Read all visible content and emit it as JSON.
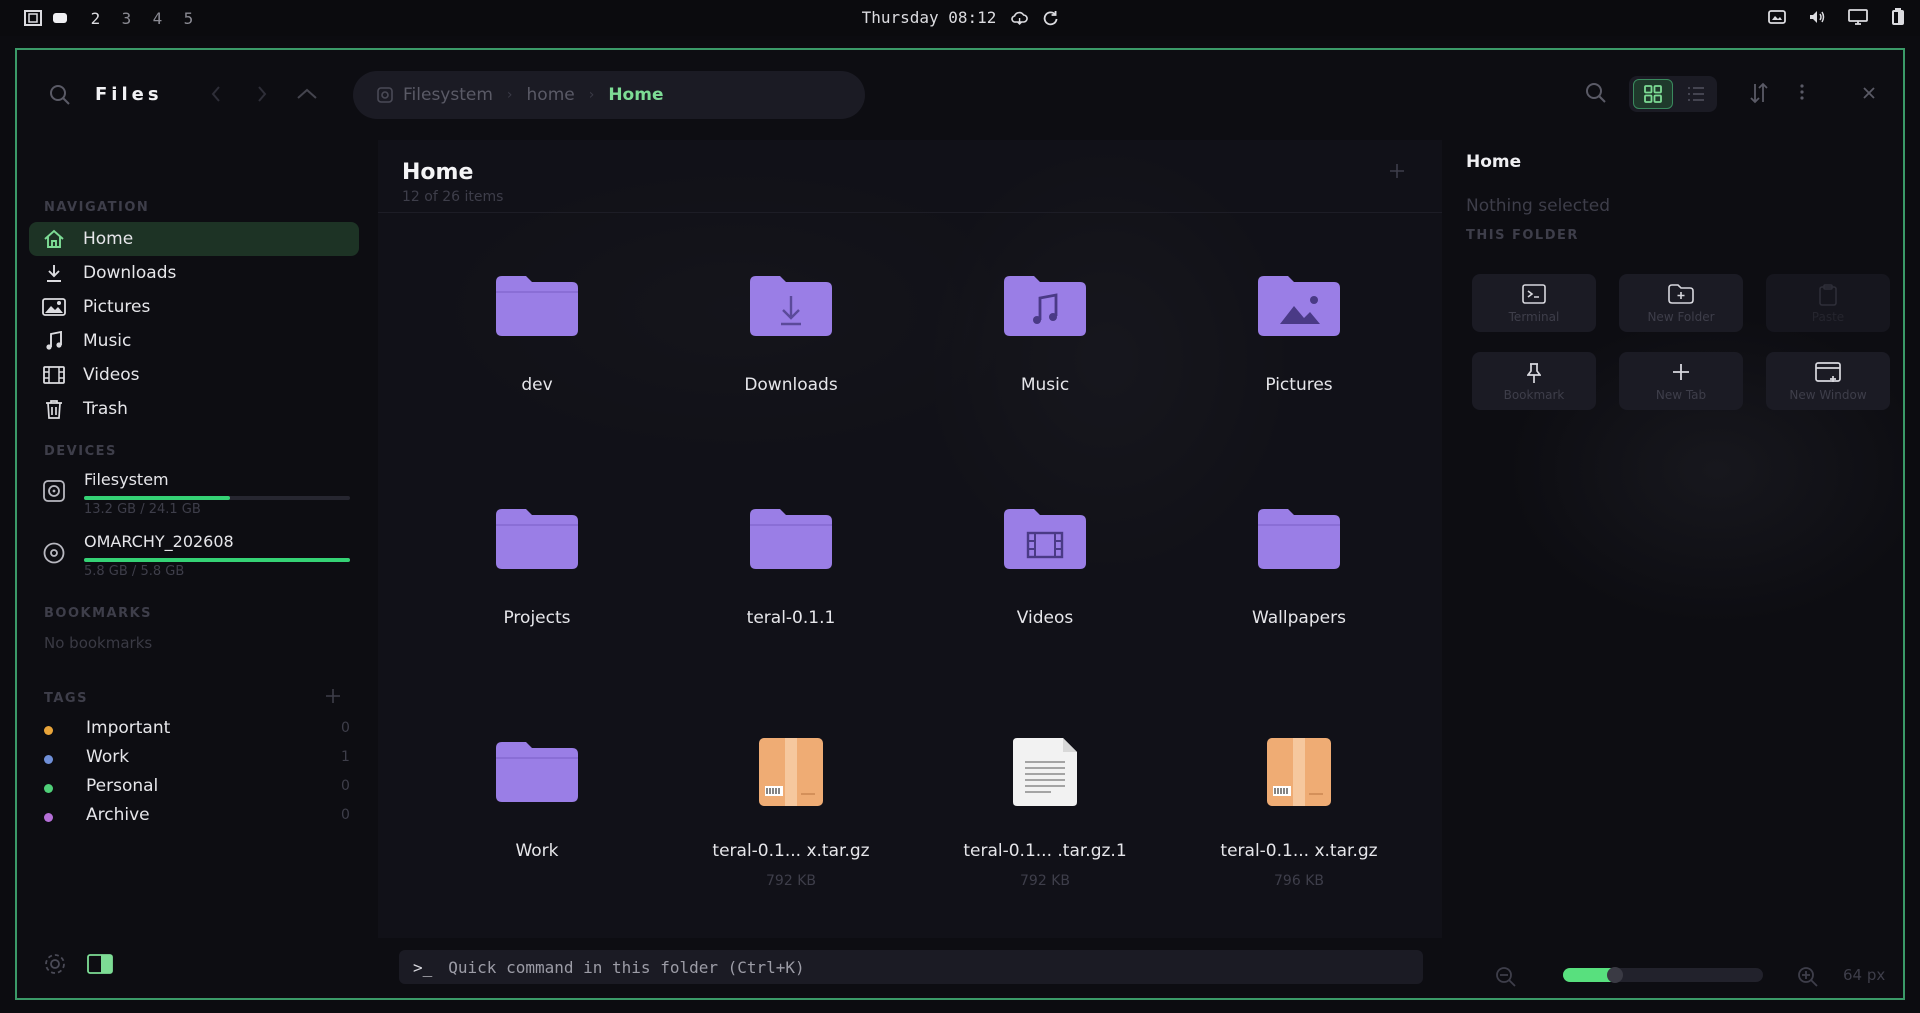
{
  "topbar": {
    "workspaces": [
      "2",
      "3",
      "4",
      "5"
    ],
    "clock": "Thursday 08:12",
    "tray_icons": [
      "screenshot-icon",
      "volume-icon",
      "display-icon",
      "battery-icon"
    ]
  },
  "header": {
    "app_title": "Files",
    "breadcrumbs": [
      "Filesystem",
      "home",
      "Home"
    ]
  },
  "sidebar": {
    "navigation_label": "NAVIGATION",
    "nav_items": [
      {
        "label": "Home",
        "icon": "home-icon",
        "active": true
      },
      {
        "label": "Downloads",
        "icon": "download-icon"
      },
      {
        "label": "Pictures",
        "icon": "image-icon"
      },
      {
        "label": "Music",
        "icon": "music-icon"
      },
      {
        "label": "Videos",
        "icon": "film-icon"
      },
      {
        "label": "Trash",
        "icon": "trash-icon"
      }
    ],
    "devices_label": "DEVICES",
    "devices": [
      {
        "name": "Filesystem",
        "usage": "13.2 GB / 24.1 GB",
        "fraction": 0.55
      },
      {
        "name": "OMARCHY_202608",
        "usage": "5.8 GB / 5.8 GB",
        "fraction": 1.0
      }
    ],
    "bookmarks_label": "BOOKMARKS",
    "no_bookmarks": "No bookmarks",
    "tags_label": "TAGS",
    "tags": [
      {
        "name": "Important",
        "count": "0",
        "color": "#e8a43a"
      },
      {
        "name": "Work",
        "count": "1",
        "color": "#6f8fd8"
      },
      {
        "name": "Personal",
        "count": "0",
        "color": "#4fcf78"
      },
      {
        "name": "Archive",
        "count": "0",
        "color": "#b56fd8"
      }
    ]
  },
  "main": {
    "title": "Home",
    "subtitle": "12 of 26 items",
    "items": [
      {
        "name": "dev",
        "kind": "folder",
        "glyph": ""
      },
      {
        "name": "Downloads",
        "kind": "folder",
        "glyph": "download"
      },
      {
        "name": "Music",
        "kind": "folder",
        "glyph": "music"
      },
      {
        "name": "Pictures",
        "kind": "folder",
        "glyph": "picture"
      },
      {
        "name": "Projects",
        "kind": "folder",
        "glyph": ""
      },
      {
        "name": "teral-0.1.1",
        "kind": "folder",
        "glyph": ""
      },
      {
        "name": "Videos",
        "kind": "folder",
        "glyph": "film"
      },
      {
        "name": "Wallpapers",
        "kind": "folder",
        "glyph": ""
      },
      {
        "name": "Work",
        "kind": "folder",
        "glyph": ""
      },
      {
        "name": "teral-0.1... x.tar.gz",
        "kind": "archive",
        "size": "792 KB"
      },
      {
        "name": "teral-0.1... .tar.gz.1",
        "kind": "text",
        "size": "792 KB"
      },
      {
        "name": "teral-0.1... x.tar.gz",
        "kind": "archive",
        "size": "796 KB"
      }
    ],
    "quick_command_prompt": ">_",
    "quick_command_placeholder": "Quick command in this folder (Ctrl+K)"
  },
  "details": {
    "title": "Home",
    "nothing_selected": "Nothing selected",
    "this_folder_label": "THIS FOLDER",
    "actions": [
      {
        "label": "Terminal",
        "icon": "terminal-icon",
        "disabled": false
      },
      {
        "label": "New Folder",
        "icon": "new-folder-icon",
        "disabled": false
      },
      {
        "label": "Paste",
        "icon": "clipboard-icon",
        "disabled": true
      },
      {
        "label": "Bookmark",
        "icon": "pin-icon",
        "disabled": false
      },
      {
        "label": "New Tab",
        "icon": "plus-icon",
        "disabled": false
      },
      {
        "label": "New Window",
        "icon": "window-icon",
        "disabled": false
      }
    ],
    "zoom_label": "64 px",
    "zoom_fraction": 0.22
  },
  "colors": {
    "accent": "#58e07e",
    "folder": "#9a7ee6",
    "window_border": "#3b9a68"
  }
}
